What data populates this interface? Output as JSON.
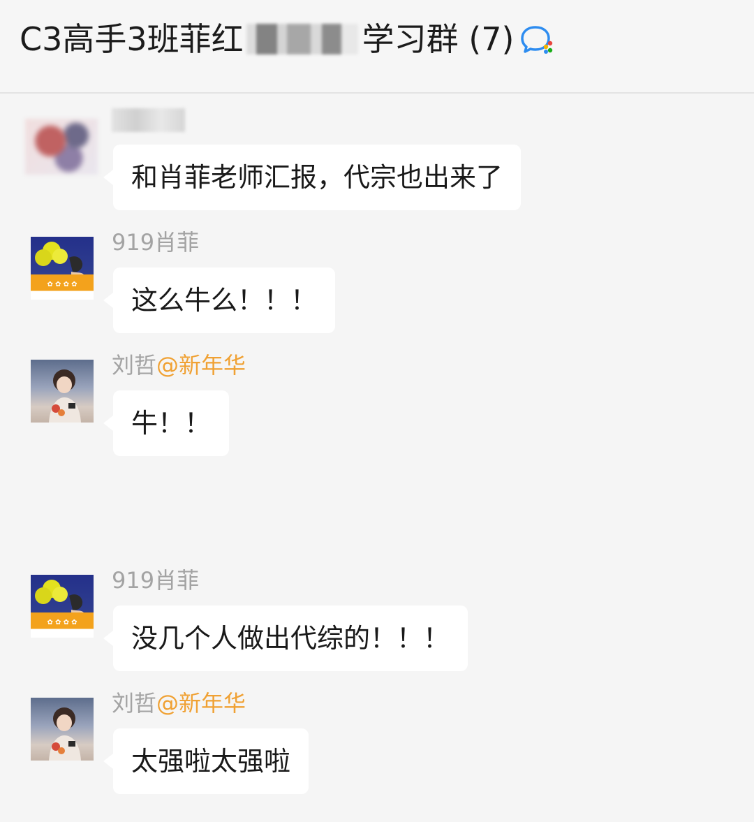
{
  "header": {
    "title_prefix": "C3高手3班菲红",
    "title_suffix": "学习群 (7)",
    "chat_icon": "group-chat-icon"
  },
  "messages": [
    {
      "sender": "",
      "sender_tag": "",
      "text": "和肖菲老师汇报，代宗也出来了",
      "avatar": "blurred-avatar"
    },
    {
      "sender": "919肖菲",
      "sender_tag": "",
      "text": "这么牛么！！！",
      "avatar": "balloon-avatar"
    },
    {
      "sender": "刘哲",
      "sender_tag": "@新年华",
      "text": "牛！！",
      "avatar": "person-avatar"
    },
    {
      "sender": "919肖菲",
      "sender_tag": "",
      "text": "没几个人做出代综的！！！",
      "avatar": "balloon-avatar"
    },
    {
      "sender": "刘哲",
      "sender_tag": "@新年华",
      "text": "太强啦太强啦",
      "avatar": "person-avatar"
    }
  ],
  "colors": {
    "background": "#f5f5f5",
    "bubble": "#ffffff",
    "sender_name": "#a3a3a3",
    "sender_tag": "#f0a133"
  }
}
